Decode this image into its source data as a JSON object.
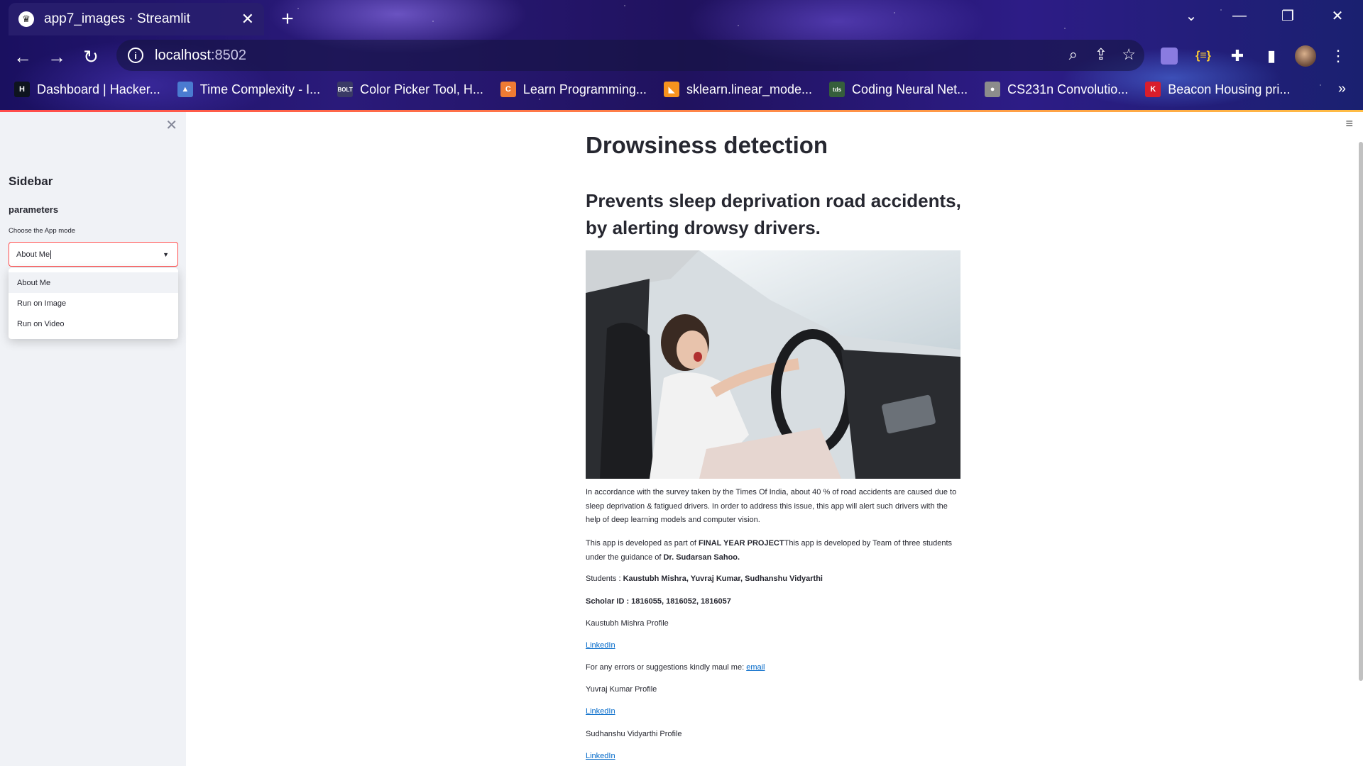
{
  "browser": {
    "tab_title": "app7_images · Streamlit",
    "tab_close": "✕",
    "new_tab": "+",
    "url_host": "localhost",
    "url_port": ":8502",
    "bookmarks": [
      {
        "label": "Dashboard | Hacker...",
        "icon_text": "H",
        "icon_color": "#0e141e"
      },
      {
        "label": "Time Complexity - I...",
        "icon_text": "▲",
        "icon_color": "#4a7bd0"
      },
      {
        "label": "Color Picker Tool, H...",
        "icon_text": "BOLT",
        "icon_color": "#3a3a66"
      },
      {
        "label": "Learn Programming...",
        "icon_text": "C",
        "icon_color": "#ef7b33"
      },
      {
        "label": "sklearn.linear_mode...",
        "icon_text": "◣",
        "icon_color": "#f7931e"
      },
      {
        "label": "Coding Neural Net...",
        "icon_text": "tds",
        "icon_color": "#355e3b"
      },
      {
        "label": "CS231n Convolutio...",
        "icon_text": "●",
        "icon_color": "#8c8c8c"
      },
      {
        "label": "Beacon Housing pri...",
        "icon_text": "K",
        "icon_color": "#d91d2b"
      }
    ],
    "bookmarks_more": "»"
  },
  "sidebar": {
    "close": "✕",
    "title": "Sidebar",
    "parameters": "parameters",
    "select_label": "Choose the App mode",
    "select_value": "About Me",
    "options": [
      "About Me",
      "Run on Image",
      "Run on Video"
    ]
  },
  "main": {
    "menu": "≡",
    "title": "Drowsiness detection",
    "subtitle": "Prevents sleep deprivation road accidents, by alerting drowsy drivers.",
    "para1": "In accordance with the survey taken by the Times Of India, about 40 % of road accidents are caused due to sleep deprivation & fatigued drivers. In order to address this issue, this app will alert such drivers with the help of deep learning models and computer vision.",
    "para2_a": "This app is developed as part of ",
    "para2_b": "FINAL YEAR PROJECT",
    "para2_c": "This app is developed by Team of three students under the guidance of ",
    "para2_d": "Dr. Sudarsan Sahoo.",
    "students_label": "Students : ",
    "students": "Kaustubh Mishra, Yuvraj Kumar, Sudhanshu Vidyarthi",
    "scholar": "Scholar ID : 1816055, 1816052, 1816057",
    "profile1": "Kaustubh Mishra Profile",
    "linkedin": "LinkedIn",
    "errors_text": "For any errors or suggestions kindly maul me: ",
    "email": "email",
    "profile2": "Yuvraj Kumar Profile",
    "profile3": "Sudhanshu Vidyarthi Profile"
  },
  "colors": {
    "accent": "#ff4b4b",
    "link": "#0068c9",
    "sidebar_bg": "#f0f2f6"
  }
}
